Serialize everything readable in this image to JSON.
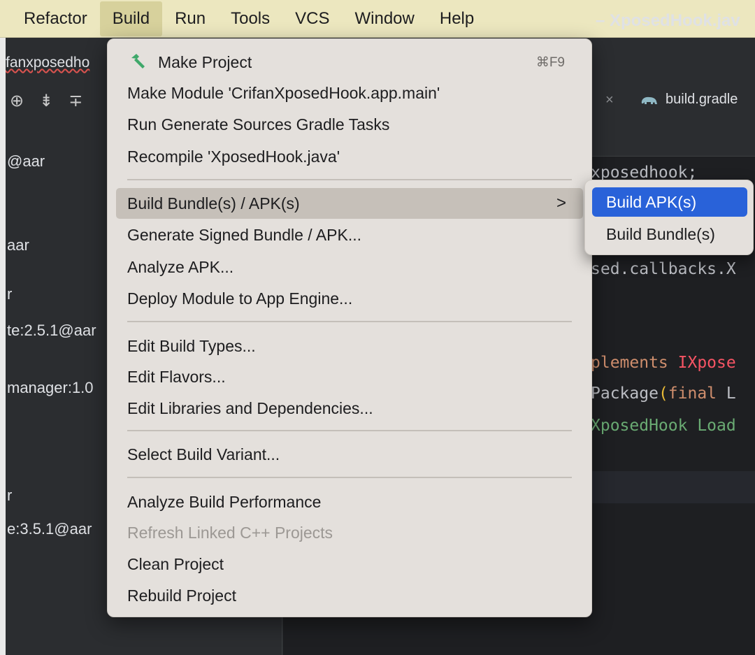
{
  "menubar": {
    "items": [
      "Refactor",
      "Build",
      "Run",
      "Tools",
      "VCS",
      "Window",
      "Help"
    ],
    "active": "Build"
  },
  "ide": {
    "title": "– XposedHook.jav",
    "breadcrumb": "fanxposedho",
    "tabs": {
      "close_glyph": "×",
      "gradle_label": "build.gradle"
    },
    "tree_rows": [
      "@aar",
      "aar",
      "r",
      "te:2.5.1@aar",
      "manager:1.0",
      "r",
      "e:3.5.1@aar"
    ],
    "code": {
      "line1": "xposedhook;",
      "line2": "sed.callbacks.X",
      "line3_kw": "plements",
      "line3_red": "IXpose",
      "line4_plain": "Package",
      "line4_brace": "(",
      "line4_kw": "final",
      "line4_tail": "L",
      "line5": "XposedHook Load"
    }
  },
  "build_menu": {
    "make_project": "Make Project",
    "make_project_shortcut": "⌘F9",
    "make_module": "Make Module 'CrifanXposedHook.app.main'",
    "run_generate": "Run Generate Sources Gradle Tasks",
    "recompile": "Recompile 'XposedHook.java'",
    "build_bundles": "Build Bundle(s) / APK(s)",
    "submenu_arrow": ">",
    "generate_signed": "Generate Signed Bundle / APK...",
    "analyze_apk": "Analyze APK...",
    "deploy_module": "Deploy Module to App Engine...",
    "edit_build_types": "Edit Build Types...",
    "edit_flavors": "Edit Flavors...",
    "edit_libraries": "Edit Libraries and Dependencies...",
    "select_variant": "Select Build Variant...",
    "analyze_performance": "Analyze Build Performance",
    "refresh_cpp": "Refresh Linked C++ Projects",
    "clean_project": "Clean Project",
    "rebuild_project": "Rebuild Project"
  },
  "build_submenu": {
    "build_apk": "Build APK(s)",
    "build_bundle": "Build Bundle(s)",
    "selected": "Build APK(s)"
  },
  "colors": {
    "menubar_bg": "#ece7bf",
    "menu_bg": "#e4e0dc",
    "selection_blue": "#2962d9",
    "hammer_green": "#3fa86a"
  }
}
